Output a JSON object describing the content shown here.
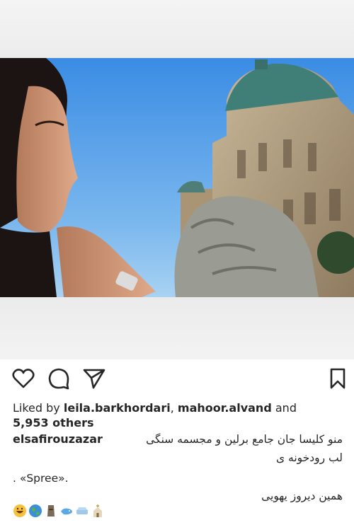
{
  "post": {
    "photo_description_icon": "selfie-with-berlin-cathedral-photo"
  },
  "actions": {
    "like_icon": "heart-icon",
    "comment_icon": "comment-icon",
    "share_icon": "send-icon",
    "save_icon": "bookmark-icon"
  },
  "likes": {
    "prefix": "Liked by ",
    "user1": "leila.barkhordari",
    "separator": ", ",
    "user2": "mahoor.alvand",
    "and": " and",
    "others": "5,953 others"
  },
  "caption": {
    "username": "elsafirouzazar",
    "line1": "منو کلیسا جان جامع برلین و مجسمه سنگی",
    "line2": "لب رودخونه ی",
    "line3": ". «Spree».",
    "line4": "همین دیروز یهویی",
    "emojis": [
      "grinning-face",
      "globe",
      "moai",
      "whale",
      "sofa",
      "church"
    ]
  },
  "colors": {
    "text": "#262626",
    "sky_top": "#3d8fe3",
    "sky_bottom": "#8fc6ef"
  }
}
